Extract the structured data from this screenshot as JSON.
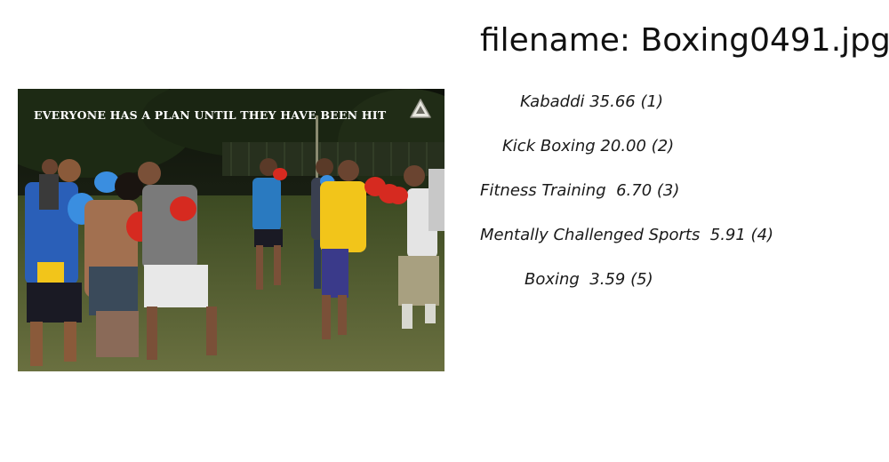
{
  "header": {
    "filename": "filename: Boxing0491.jpg"
  },
  "photo": {
    "caption": "EVERYONE HAS A PLAN UNTIL THEY HAVE BEEN HIT"
  },
  "predictions": [
    {
      "label": "Kabaddi 35.66 (1)",
      "indent": 45
    },
    {
      "label": "Kick Boxing 20.00 (2)",
      "indent": 25
    },
    {
      "label": "Fitness Training  6.70 (3)",
      "indent": 0
    },
    {
      "label": "Mentally Challenged Sports  5.91 (4)",
      "indent": 0
    },
    {
      "label": "Boxing  3.59 (5)",
      "indent": 50
    }
  ],
  "colors": {
    "grass": "#4a5a2a",
    "night_sky": "#151a10",
    "shirt_blue": "#2a5fb8",
    "shirt_yellow": "#f2c51a",
    "glove_red": "#d62a20",
    "glove_blue": "#3a8ee0"
  }
}
